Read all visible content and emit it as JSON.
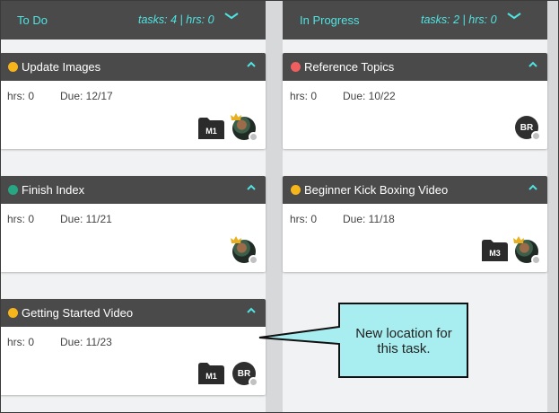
{
  "columns": [
    {
      "title": "To Do",
      "stats": "tasks: 4 | hrs: 0",
      "cards": [
        {
          "name": "Update Images",
          "dot_color": "#f5b51b",
          "hrs": "hrs: 0",
          "due": "Due: 12/17",
          "folder": "M1",
          "avatar": "photo"
        },
        {
          "name": "Finish Index",
          "dot_color": "#27a683",
          "hrs": "hrs: 0",
          "due": "Due: 11/21",
          "folder": "",
          "avatar": "photo"
        },
        {
          "name": "Getting Started Video",
          "dot_color": "#f5b51b",
          "hrs": "hrs: 0",
          "due": "Due: 11/23",
          "folder": "M1",
          "avatar": "BR"
        }
      ]
    },
    {
      "title": "In Progress",
      "stats": "tasks: 2 | hrs: 0",
      "cards": [
        {
          "name": "Reference Topics",
          "dot_color": "#f05f5f",
          "hrs": "hrs: 0",
          "due": "Due: 10/22",
          "folder": "",
          "avatar": "BR"
        },
        {
          "name": "Beginner Kick Boxing Video",
          "dot_color": "#f5b51b",
          "hrs": "hrs: 0",
          "due": "Due: 11/18",
          "folder": "M3",
          "avatar": "photo"
        }
      ]
    }
  ],
  "callout": {
    "line1": "New location for",
    "line2": "this task.",
    "fill": "#a8eef0"
  },
  "colors": {
    "accent": "#4fe3e1",
    "header": "#4a4a4a"
  }
}
